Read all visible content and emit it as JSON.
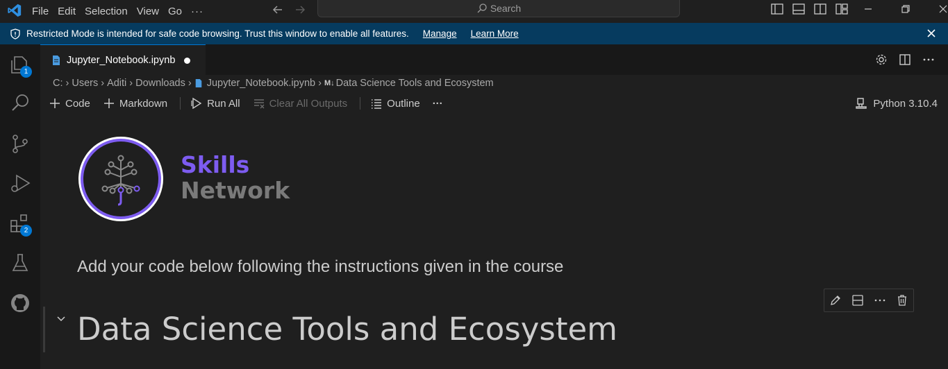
{
  "menu": {
    "items": [
      "File",
      "Edit",
      "Selection",
      "View",
      "Go"
    ],
    "more": "···"
  },
  "search": {
    "placeholder": "Search"
  },
  "banner": {
    "text": "Restricted Mode is intended for safe code browsing. Trust this window to enable all features.",
    "manage": "Manage",
    "learn_more": "Learn More"
  },
  "activity": {
    "explorer_badge": "1",
    "extensions_badge": "2"
  },
  "tab": {
    "label": "Jupyter_Notebook.ipynb"
  },
  "breadcrumb": {
    "items": [
      "C:",
      "Users",
      "Aditi",
      "Downloads",
      "Jupyter_Notebook.ipynb",
      "Data Science Tools and Ecosystem"
    ],
    "md_prefix": "M↓"
  },
  "toolbar": {
    "code": "Code",
    "markdown": "Markdown",
    "run_all": "Run All",
    "clear_all_outputs": "Clear All Outputs",
    "outline": "Outline",
    "more": "···"
  },
  "kernel": {
    "label": "Python 3.10.4"
  },
  "notebook": {
    "logo_line1": "Skills",
    "logo_line2": "Network",
    "instructions": "Add your code below following the instructions given in the course",
    "heading": "Data Science Tools and Ecosystem"
  },
  "colors": {
    "accent": "#0078d4",
    "banner_bg": "#063b5f",
    "skills_purple": "#7d5cf0"
  }
}
